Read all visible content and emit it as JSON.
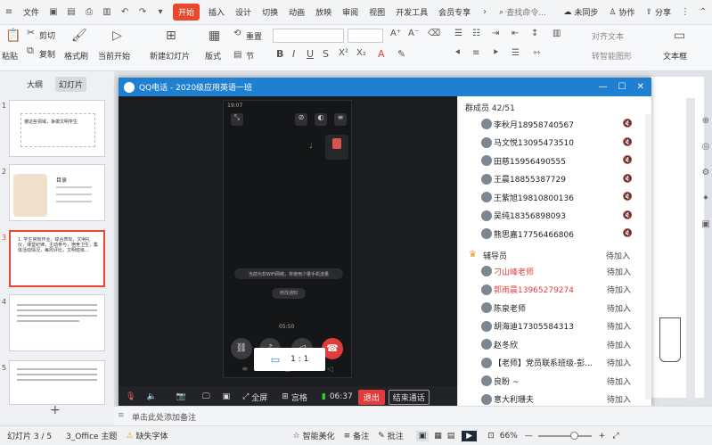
{
  "menubar": {
    "file": "文件",
    "tabs": [
      "开始",
      "插入",
      "设计",
      "切换",
      "动画",
      "放映",
      "审阅",
      "视图",
      "开发工具",
      "会员专享"
    ],
    "active_tab": "开始",
    "search_placeholder": "查找命令...",
    "unsync": "未同步",
    "collab": "协作",
    "share": "分享"
  },
  "ribbon": {
    "paste": "粘贴",
    "cut": "剪切",
    "copy": "复制",
    "format_painter": "格式刷",
    "from_current": "当前开始",
    "new_slide": "新建幻灯片",
    "layout": "版式",
    "section": "节",
    "reset": "重置",
    "text_direction": "对齐文本",
    "convert_smartart": "转智能图形",
    "textbox": "文本框"
  },
  "leftpanel": {
    "tab_outline": "大纲",
    "tab_slides": "幻灯片",
    "slide_numbers": [
      "1",
      "2",
      "3",
      "4",
      "5"
    ],
    "thumb1_text": "遵这些领域，争做文明学生",
    "thumb2_text": "目录",
    "thumb3_text": "1. 学生常规作业，综合表现，文明礼仪，课堂纪律，主动参与，宿舍卫生，集体活动情况，每周评比，文明班级..."
  },
  "qq": {
    "title": "QQ电话 - 2020级应用英语一班",
    "phone_time": "19:07",
    "wifi_notice": "当前为非WiFi网络，将使用少量手机流量",
    "notice_small": "修改通知",
    "call_time_small": "05:50",
    "ratio": "1 : 1",
    "ctrl_fullscreen": "全屏",
    "ctrl_grid": "宫格",
    "ctrl_time": "06:37",
    "ctrl_exit": "退出",
    "ctrl_end": "结束通话",
    "members_header": "群成员 42/51",
    "members": [
      {
        "name": "李秋月18958740567",
        "status": "muted",
        "color": "#222"
      },
      {
        "name": "马文悦13095473510",
        "status": "muted",
        "color": "#222"
      },
      {
        "name": "田慈15956490555",
        "status": "muted",
        "color": "#222"
      },
      {
        "name": "王晨18855387729",
        "status": "muted",
        "color": "#222"
      },
      {
        "name": "王紫旭19810800136",
        "status": "muted",
        "color": "#222"
      },
      {
        "name": "吴纯18356898093",
        "status": "muted",
        "color": "#222"
      },
      {
        "name": "熊思嘉17756466806",
        "status": "muted",
        "color": "#222"
      }
    ],
    "helper_label": "辅导员",
    "helper_status": "待加入",
    "pending": [
      {
        "name": "刁山峰老师",
        "color": "#e03c3c"
      },
      {
        "name": "郭雨晨13965279274",
        "color": "#e03c3c"
      },
      {
        "name": "陈泉老师",
        "color": "#222"
      },
      {
        "name": "胡海迪17305584313",
        "color": "#222"
      },
      {
        "name": "赵冬欣",
        "color": "#222"
      },
      {
        "name": "【老师】党员联系班级-彭...",
        "color": "#222"
      },
      {
        "name": "良盼 ~",
        "color": "#222"
      },
      {
        "name": "意大利珊夫",
        "color": "#222"
      }
    ],
    "pending_status": "待加入"
  },
  "notes_placeholder": "单击此处添加备注",
  "statusbar": {
    "slide_info": "幻灯片 3 / 5",
    "theme": "3_Office 主题",
    "missing_font": "缺失字体",
    "smart_beautify": "智能美化",
    "notes": "备注",
    "comments": "批注",
    "zoom": "66%"
  },
  "colors": {
    "accent": "#e8482c",
    "qq_blue": "#1f7fd0",
    "end_call": "#e23b3b"
  }
}
